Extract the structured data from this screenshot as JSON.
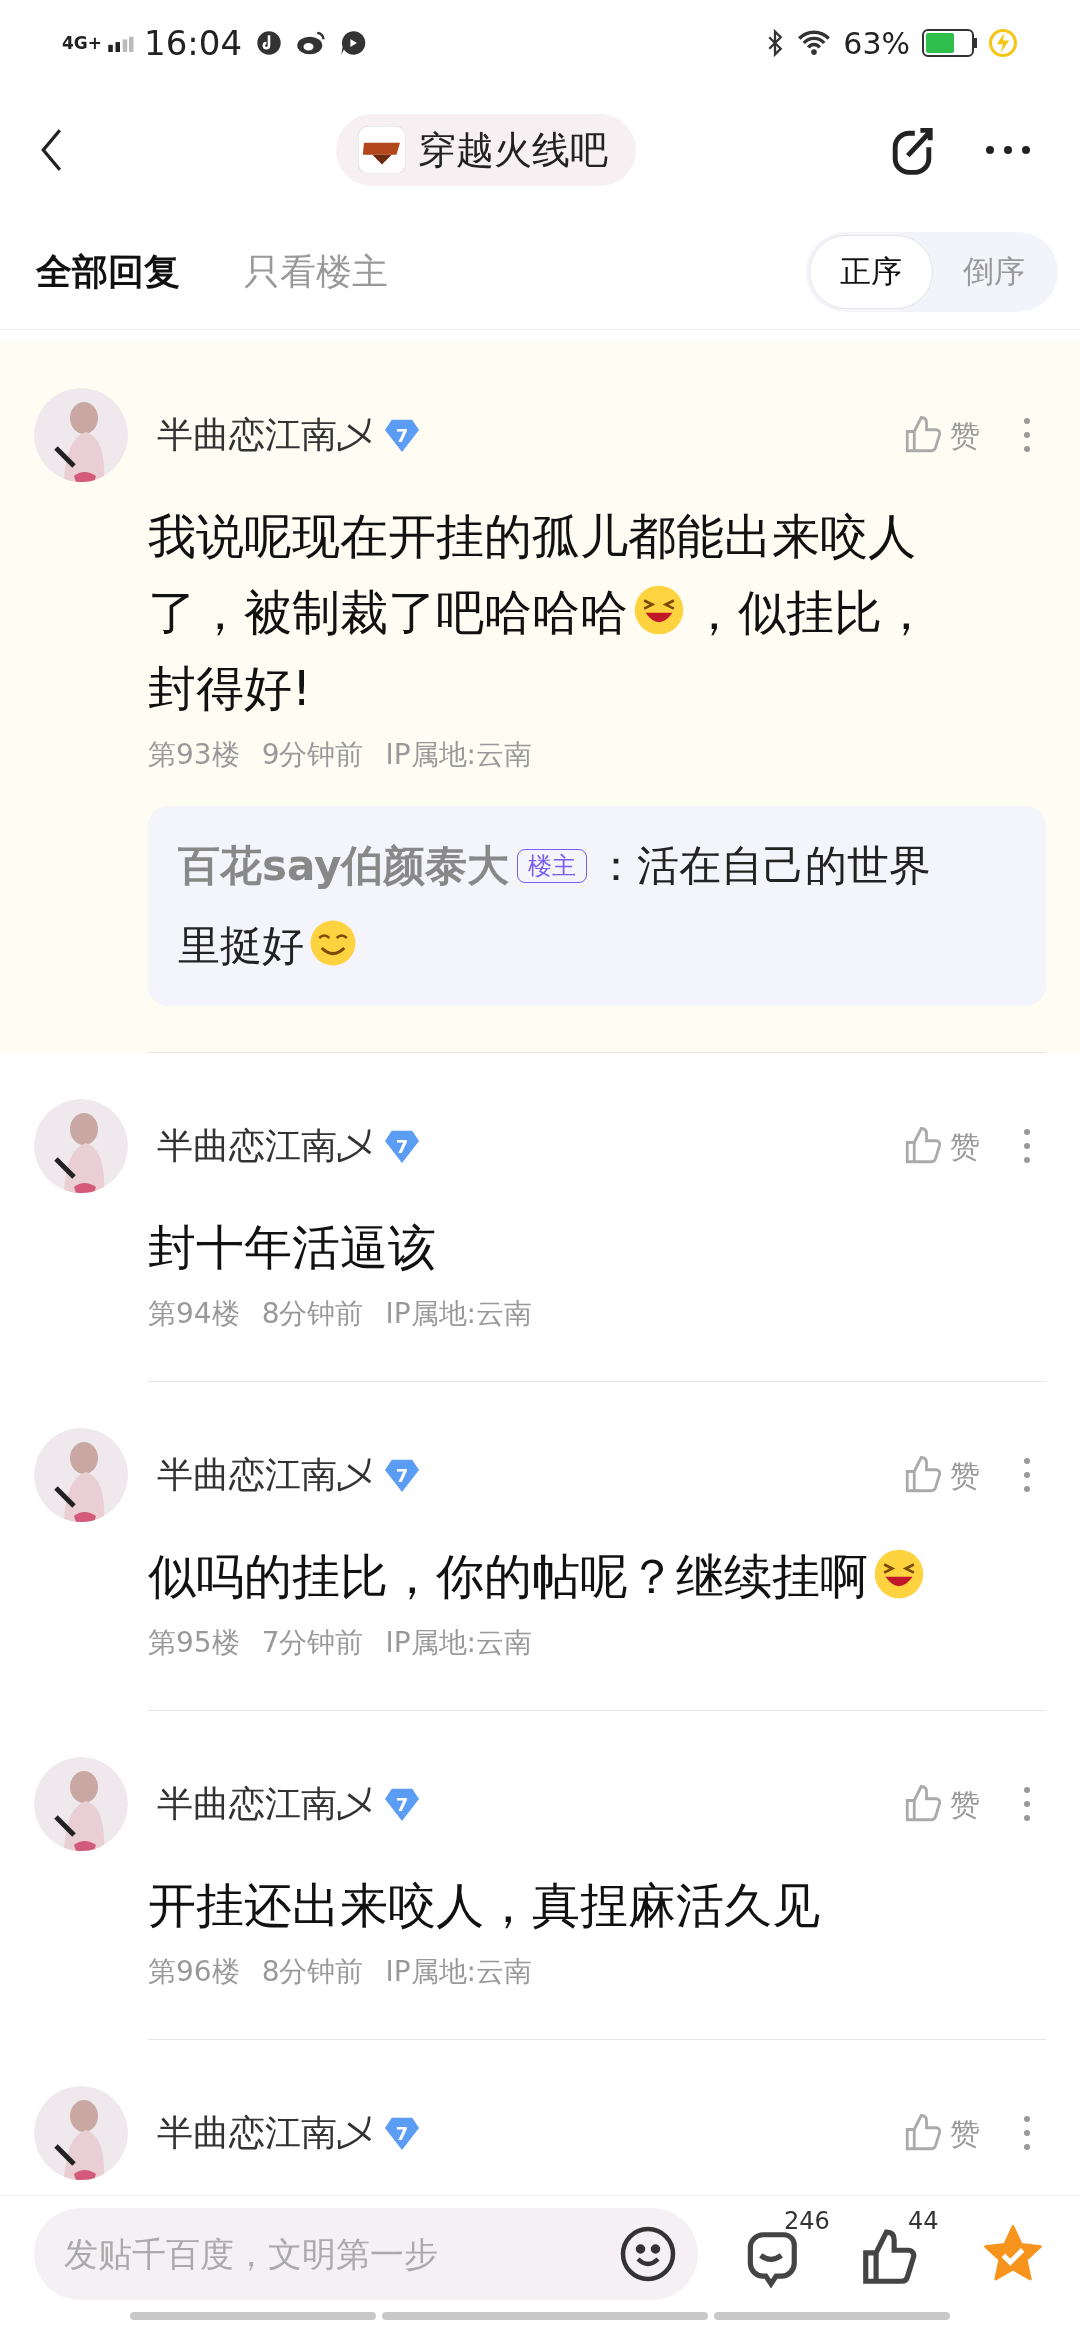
{
  "status_bar": {
    "network": "4G+",
    "time": "16:04",
    "battery": "63%"
  },
  "header": {
    "forum": "穿越火线吧"
  },
  "tabs": [
    {
      "label": "全部回复",
      "selected": true
    },
    {
      "label": "只看楼主",
      "selected": false
    }
  ],
  "sort": [
    {
      "label": "正序",
      "selected": true
    },
    {
      "label": "倒序",
      "selected": false
    }
  ],
  "posts": [
    {
      "author": "半曲恋江南乄",
      "level": "7",
      "like": "赞",
      "highlighted": true,
      "content": [
        {
          "kind": "text",
          "text": "我说呢现在开挂的孤儿都能出来咬人"
        },
        {
          "kind": "text",
          "text": "了，被制裁了吧哈哈哈"
        },
        {
          "kind": "laugh"
        },
        {
          "kind": "text",
          "text": "，似挂比，"
        },
        {
          "kind": "text",
          "text": "封得好!"
        }
      ],
      "floor": "第93楼",
      "time": "9分钟前",
      "ip": "IP属地:云南",
      "reply": {
        "author": "百花say伯颜泰大",
        "badge": "楼主",
        "content": [
          {
            "kind": "text",
            "text": "：活在自己的世界"
          },
          {
            "kind": "text",
            "text": "里挺好"
          },
          {
            "kind": "smile"
          }
        ]
      }
    },
    {
      "author": "半曲恋江南乄",
      "level": "7",
      "like": "赞",
      "highlighted": false,
      "content": [
        {
          "kind": "text",
          "text": "封十年活逼该"
        }
      ],
      "floor": "第94楼",
      "time": "8分钟前",
      "ip": "IP属地:云南"
    },
    {
      "author": "半曲恋江南乄",
      "level": "7",
      "like": "赞",
      "highlighted": false,
      "content": [
        {
          "kind": "text",
          "text": "似吗的挂比，你的帖呢？继续挂啊"
        },
        {
          "kind": "laugh"
        }
      ],
      "floor": "第95楼",
      "time": "7分钟前",
      "ip": "IP属地:云南"
    },
    {
      "author": "半曲恋江南乄",
      "level": "7",
      "like": "赞",
      "highlighted": false,
      "content": [
        {
          "kind": "text",
          "text": "开挂还出来咬人，真捏麻活久见"
        }
      ],
      "floor": "第96楼",
      "time": "8分钟前",
      "ip": "IP属地:云南"
    },
    {
      "author": "半曲恋江南乄",
      "level": "7",
      "like": "赞",
      "highlighted": false
    }
  ],
  "bottom_bar": {
    "placeholder": "发贴千百度，文明第一步",
    "comments": "246",
    "likes": "44"
  }
}
